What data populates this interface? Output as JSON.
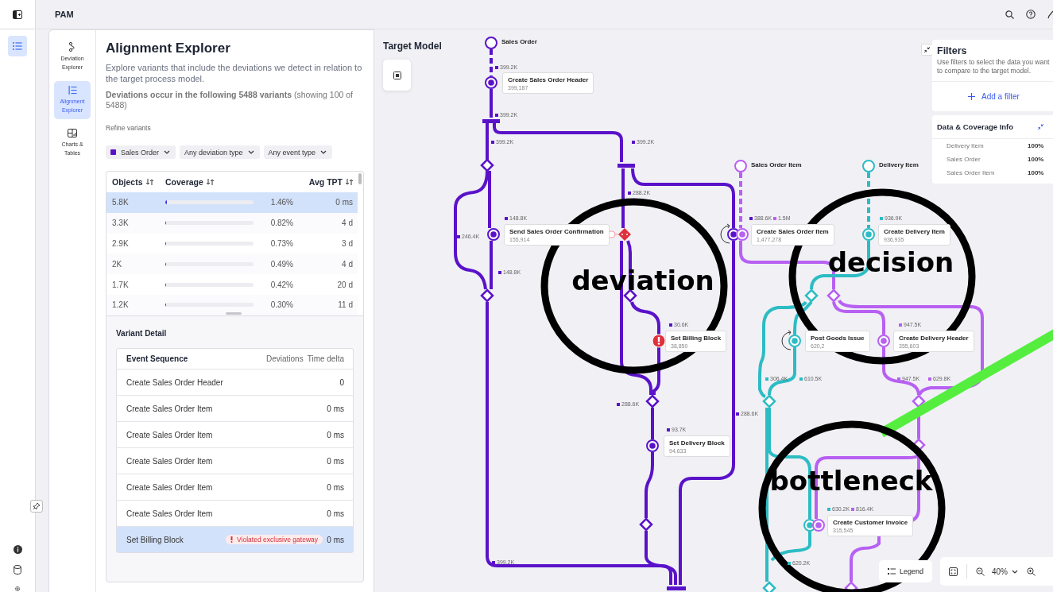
{
  "app_bar": {
    "title": "PAM"
  },
  "rail": {
    "items": [
      {
        "kind": "list",
        "selected": true
      }
    ],
    "bottom": [
      {
        "kind": "pin"
      },
      {
        "kind": "info"
      },
      {
        "kind": "database"
      },
      {
        "kind": "settings"
      }
    ]
  },
  "nav": [
    {
      "label": "Deviation Explorer",
      "kind": "deviation",
      "selected": false
    },
    {
      "label": "Alignment Explorer",
      "kind": "alignment",
      "selected": true
    },
    {
      "label": "Charts & Tables",
      "kind": "charts",
      "selected": false
    }
  ],
  "panel": {
    "title": "Alignment Explorer",
    "description": "Explore variants that include the deviations we detect in relation to the target process model.",
    "summary": "**Deviations occur in the following 5488 variants** (showing 100 of 5488)",
    "refine_label": "Refine variants",
    "filters": [
      {
        "label": "Sales Order",
        "color": "#5a12c9"
      },
      {
        "label": "Any deviation type"
      },
      {
        "label": "Any event type"
      }
    ]
  },
  "variants_table": {
    "columns": [
      "Objects",
      "Coverage",
      "Avg TPT"
    ],
    "rows": [
      {
        "objects": "5.8K",
        "level": 0.0146,
        "coverage": "1.46%",
        "avg_tpt": "0 ms",
        "selected": true
      },
      {
        "objects": "3.3K",
        "level": 0.0082,
        "coverage": "0.82%",
        "avg_tpt": "4 d",
        "selected": false
      },
      {
        "objects": "2.9K",
        "level": 0.0073,
        "coverage": "0.73%",
        "avg_tpt": "3 d",
        "selected": false
      },
      {
        "objects": "2K",
        "level": 0.0049,
        "coverage": "0.49%",
        "avg_tpt": "4 d",
        "selected": false
      },
      {
        "objects": "1.7K",
        "level": 0.0042,
        "coverage": "0.42%",
        "avg_tpt": "20 d",
        "selected": false
      },
      {
        "objects": "1.2K",
        "level": 0.003,
        "coverage": "0.30%",
        "avg_tpt": "11 d",
        "selected": false
      }
    ]
  },
  "variant_detail": {
    "title": "Variant Detail",
    "columns": [
      "Event Sequence",
      "Deviations",
      "Time delta"
    ],
    "rows": [
      {
        "event": "Create Sales Order Header",
        "time_delta": "0",
        "selected": false
      },
      {
        "event": "Create Sales Order Item",
        "time_delta": "0 ms",
        "selected": false
      },
      {
        "event": "Create Sales Order Item",
        "time_delta": "0 ms",
        "selected": false
      },
      {
        "event": "Create Sales Order Item",
        "time_delta": "0 ms",
        "selected": false
      },
      {
        "event": "Create Sales Order Item",
        "time_delta": "0 ms",
        "selected": false
      },
      {
        "event": "Create Sales Order Item",
        "time_delta": "0 ms",
        "selected": false
      },
      {
        "event": "Set Billing Block",
        "deviation": "Violated exclusive gateway",
        "time_delta": "0 ms",
        "selected": true
      }
    ]
  },
  "target_model": {
    "title": "Target Model",
    "start_nodes": [
      {
        "label": "Sales Order",
        "color": "#5a12c9"
      },
      {
        "label": "Sales Order Item",
        "color": "#b760f2"
      },
      {
        "label": "Delivery Item",
        "color": "#2cbcc4"
      }
    ],
    "activities": [
      {
        "label": "Create Sales Order Header",
        "count": "399,187",
        "kind": "normal",
        "markers": [
          {
            "color": "#5a12c9"
          }
        ]
      },
      {
        "label": "Send Sales Order Confirmation",
        "count": "155,914",
        "kind": "normal",
        "markers": [
          {
            "color": "#5a12c9"
          }
        ]
      },
      {
        "label": "Create Sales Order Item",
        "count": "1,477,278",
        "kind": "normal",
        "markers": [
          {
            "color": "#5a12c9"
          },
          {
            "color": "#b760f2"
          }
        ]
      },
      {
        "label": "Create Delivery Item",
        "count": "936,935",
        "kind": "normal",
        "markers": [
          {
            "color": "#2cbcc4"
          }
        ]
      },
      {
        "label": "Set Billing Block",
        "count": "38,850",
        "kind": "deviation",
        "markers": [
          {
            "color": "#e0303c"
          }
        ]
      },
      {
        "label": "Post Goods Issue",
        "count": "620,2",
        "kind": "normal",
        "markers": [
          {
            "color": "#2cbcc4"
          }
        ]
      },
      {
        "label": "Create Delivery Header",
        "count": "355,603",
        "kind": "normal",
        "markers": [
          {
            "color": "#b760f2"
          }
        ]
      },
      {
        "label": "Set Delivery Block",
        "count": "94,633",
        "kind": "normal",
        "markers": [
          {
            "color": "#5a12c9"
          }
        ]
      },
      {
        "label": "Create Customer Invoice",
        "count": "315,545",
        "kind": "normal",
        "markers": [
          {
            "color": "#2cbcc4"
          },
          {
            "color": "#b760f2"
          }
        ]
      }
    ],
    "edge_labels": [
      {
        "text": "399.2K",
        "color": "#5a12c9"
      },
      {
        "text": "399.2K",
        "color": "#5a12c9"
      },
      {
        "text": "399.2K",
        "color": "#5a12c9"
      },
      {
        "text": "399.2K",
        "color": "#5a12c9"
      },
      {
        "text": "288.2K",
        "color": "#5a12c9"
      },
      {
        "text": "148.8K",
        "color": "#5a12c9"
      },
      {
        "text": "246.4K",
        "color": "#5a12c9"
      },
      {
        "text": "148.8K",
        "color": "#5a12c9"
      },
      {
        "text": "388.6K",
        "color": "#5a12c9"
      },
      {
        "text": "1.5M",
        "color": "#b760f2"
      },
      {
        "text": "936.9K",
        "color": "#2cbcc4"
      },
      {
        "text": "30.6K",
        "color": "#5a12c9"
      },
      {
        "text": "93.7K",
        "color": "#5a12c9"
      },
      {
        "text": "288.6K",
        "color": "#5a12c9"
      },
      {
        "text": "288.6K",
        "color": "#5a12c9"
      },
      {
        "text": "947.5K",
        "color": "#b760f2"
      },
      {
        "text": "306.4K",
        "color": "#2cbcc4"
      },
      {
        "text": "610.5K",
        "color": "#2cbcc4"
      },
      {
        "text": "947.5K",
        "color": "#b760f2"
      },
      {
        "text": "629.8K",
        "color": "#b760f2"
      },
      {
        "text": "630.2K",
        "color": "#2cbcc4"
      },
      {
        "text": "816.4K",
        "color": "#b760f2"
      },
      {
        "text": "620.2K",
        "color": "#2cbcc4"
      },
      {
        "text": "399.2K",
        "color": "#5a12c9"
      }
    ],
    "annotations": [
      {
        "kind": "circle",
        "text": "deviation"
      },
      {
        "kind": "circle",
        "text": "decision"
      },
      {
        "kind": "line"
      },
      {
        "kind": "circle",
        "text": "bottleneck"
      }
    ]
  },
  "filters_panel": {
    "title": "Filters",
    "description_lines": [
      "Use filters to select the data you want",
      "to compare to the target model."
    ],
    "add_button": "Add a filter"
  },
  "coverage_panel": {
    "title": "Data & Coverage Info",
    "rows": [
      {
        "label": "Delivery Item",
        "value": "100%"
      },
      {
        "label": "Sales Order",
        "value": "100%"
      },
      {
        "label": "Sales Order Item",
        "value": "100%"
      }
    ]
  },
  "canvas_controls": {
    "legend": "Legend",
    "zoom": "40%"
  }
}
